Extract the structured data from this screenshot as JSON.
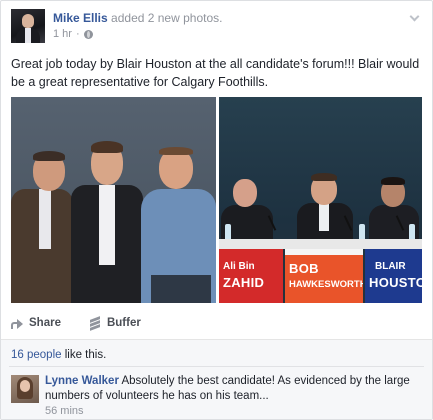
{
  "post": {
    "author": "Mike Ellis",
    "action": "added 2 new photos.",
    "timestamp": "1 hr",
    "meta_separator": "·",
    "text": "Great job today by Blair Houston at the all candidate's forum!!! Blair would be a great representative for Calgary Foothills."
  },
  "photo2_signs": [
    {
      "small": "Ali Bin",
      "big": "ZAHID"
    },
    {
      "small": "",
      "big": "BOB"
    },
    {
      "small": "HAWKESWORTH",
      "big": ""
    },
    {
      "small": "BLAIR",
      "big": "HOUSTO"
    }
  ],
  "actions": {
    "share_label": "Share",
    "buffer_label": "Buffer"
  },
  "likes": {
    "count_link": "16 people",
    "suffix": "like this."
  },
  "comment": {
    "author": "Lynne Walker",
    "text": "Absolutely the best candidate! As evidenced by the large numbers of volunteers he has on his team...",
    "time": "56 mins"
  },
  "colors": {
    "link": "#365899",
    "muted": "#90949c",
    "sign_red": "#d32a2a",
    "sign_orange": "#e9542a",
    "sign_blue": "#1e3a8f"
  }
}
